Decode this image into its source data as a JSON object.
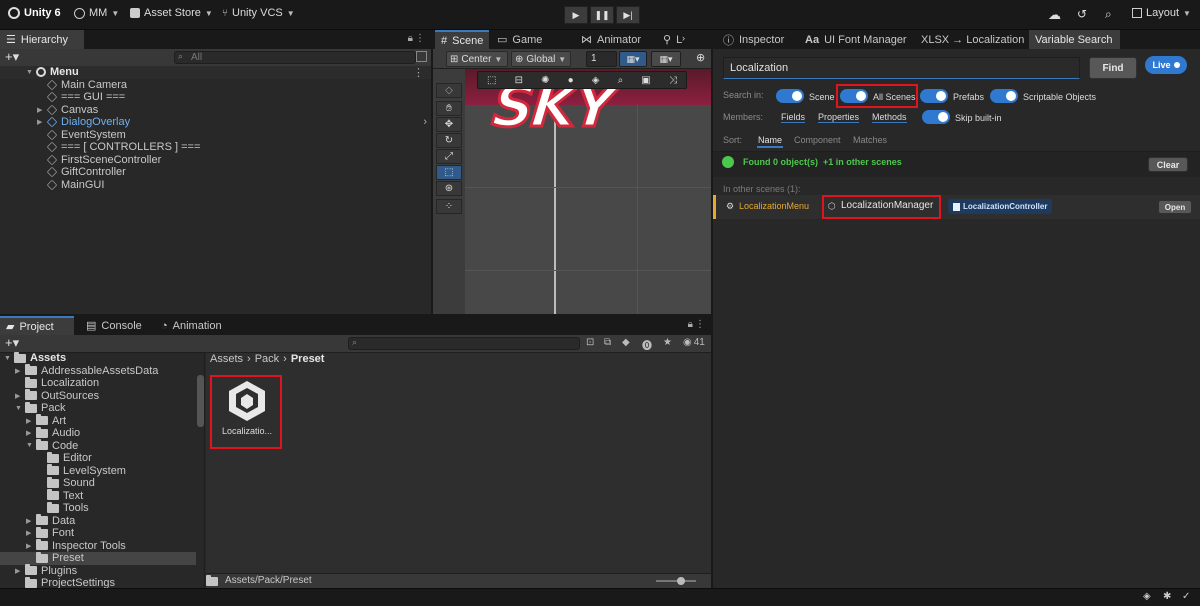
{
  "toolbar": {
    "app_title": "Unity 6",
    "account": "MM",
    "asset_store": "Asset Store",
    "vcs": "Unity VCS",
    "layout": "Layout"
  },
  "hierarchy": {
    "tab": "Hierarchy",
    "search_placeholder": "All",
    "scene_name": "Menu",
    "items": [
      {
        "label": "Main Camera",
        "expandable": false,
        "color": "#c8c8c8"
      },
      {
        "label": "=== GUI ===",
        "expandable": false,
        "color": "#c8c8c8"
      },
      {
        "label": "Canvas",
        "expandable": true,
        "color": "#c8c8c8"
      },
      {
        "label": "DialogOverlay",
        "expandable": true,
        "color": "#6fb0f0"
      },
      {
        "label": "EventSystem",
        "expandable": false,
        "color": "#c8c8c8"
      },
      {
        "label": "=== [ CONTROLLERS ] ===",
        "expandable": false,
        "color": "#c8c8c8"
      },
      {
        "label": "FirstSceneController",
        "expandable": false,
        "color": "#c8c8c8"
      },
      {
        "label": "GiftController",
        "expandable": false,
        "color": "#c8c8c8"
      },
      {
        "label": "MainGUI",
        "expandable": false,
        "color": "#c8c8c8"
      }
    ]
  },
  "scene": {
    "tabs": [
      "Scene",
      "Game",
      "Animator",
      "L"
    ],
    "pivot": "Center",
    "space": "Global",
    "snap_value": "1",
    "game_text": "SKY"
  },
  "project": {
    "tabs": [
      "Project",
      "Console",
      "Animation"
    ],
    "asset_count": "41",
    "tree_root": "Assets",
    "tree": [
      {
        "label": "AddressableAssetsData",
        "depth": 1,
        "arrow": "right"
      },
      {
        "label": "Localization",
        "depth": 1,
        "arrow": "none"
      },
      {
        "label": "OutSources",
        "depth": 1,
        "arrow": "right"
      },
      {
        "label": "Pack",
        "depth": 1,
        "arrow": "down"
      },
      {
        "label": "Art",
        "depth": 2,
        "arrow": "right"
      },
      {
        "label": "Audio",
        "depth": 2,
        "arrow": "right"
      },
      {
        "label": "Code",
        "depth": 2,
        "arrow": "down"
      },
      {
        "label": "Editor",
        "depth": 3,
        "arrow": "none"
      },
      {
        "label": "LevelSystem",
        "depth": 3,
        "arrow": "none"
      },
      {
        "label": "Sound",
        "depth": 3,
        "arrow": "none"
      },
      {
        "label": "Text",
        "depth": 3,
        "arrow": "none"
      },
      {
        "label": "Tools",
        "depth": 3,
        "arrow": "none"
      },
      {
        "label": "Data",
        "depth": 2,
        "arrow": "right"
      },
      {
        "label": "Font",
        "depth": 2,
        "arrow": "right"
      },
      {
        "label": "Inspector Tools",
        "depth": 2,
        "arrow": "right"
      },
      {
        "label": "Preset",
        "depth": 2,
        "arrow": "none",
        "selected": true
      },
      {
        "label": "Plugins",
        "depth": 1,
        "arrow": "right"
      },
      {
        "label": "ProjectSettings",
        "depth": 1,
        "arrow": "none"
      }
    ],
    "breadcrumb": [
      "Assets",
      "Pack",
      "Preset"
    ],
    "asset_label": "Localizatio...",
    "footer_path": "Assets/Pack/Preset"
  },
  "right": {
    "tabs": [
      "Inspector",
      "UI Font Manager",
      "XLSX → Localization",
      "Variable Search"
    ]
  },
  "variable_search": {
    "query": "Localization",
    "find_label": "Find",
    "live_label": "Live",
    "search_in_label": "Search in:",
    "search_in": [
      "Scene",
      "All Scenes",
      "Prefabs",
      "Scriptable Objects"
    ],
    "members_label": "Members:",
    "members": [
      "Fields",
      "Properties",
      "Methods"
    ],
    "skip_builtin": "Skip built-in",
    "sort_label": "Sort:",
    "sort_options": [
      "Name",
      "Component",
      "Matches"
    ],
    "status_found": "Found 0 object(s)",
    "status_other": "+1 in other scenes",
    "clear_label": "Clear",
    "other_scenes_label": "In other scenes (1):",
    "result": {
      "scene": "LocalizationMenu",
      "object": "LocalizationManager",
      "component": "LocalizationController",
      "open_label": "Open"
    }
  },
  "colors": {
    "accent": "#2f79d0",
    "highlight": "#e0141e",
    "found_green": "#4cc94c",
    "scene_orange": "#e8a830"
  }
}
